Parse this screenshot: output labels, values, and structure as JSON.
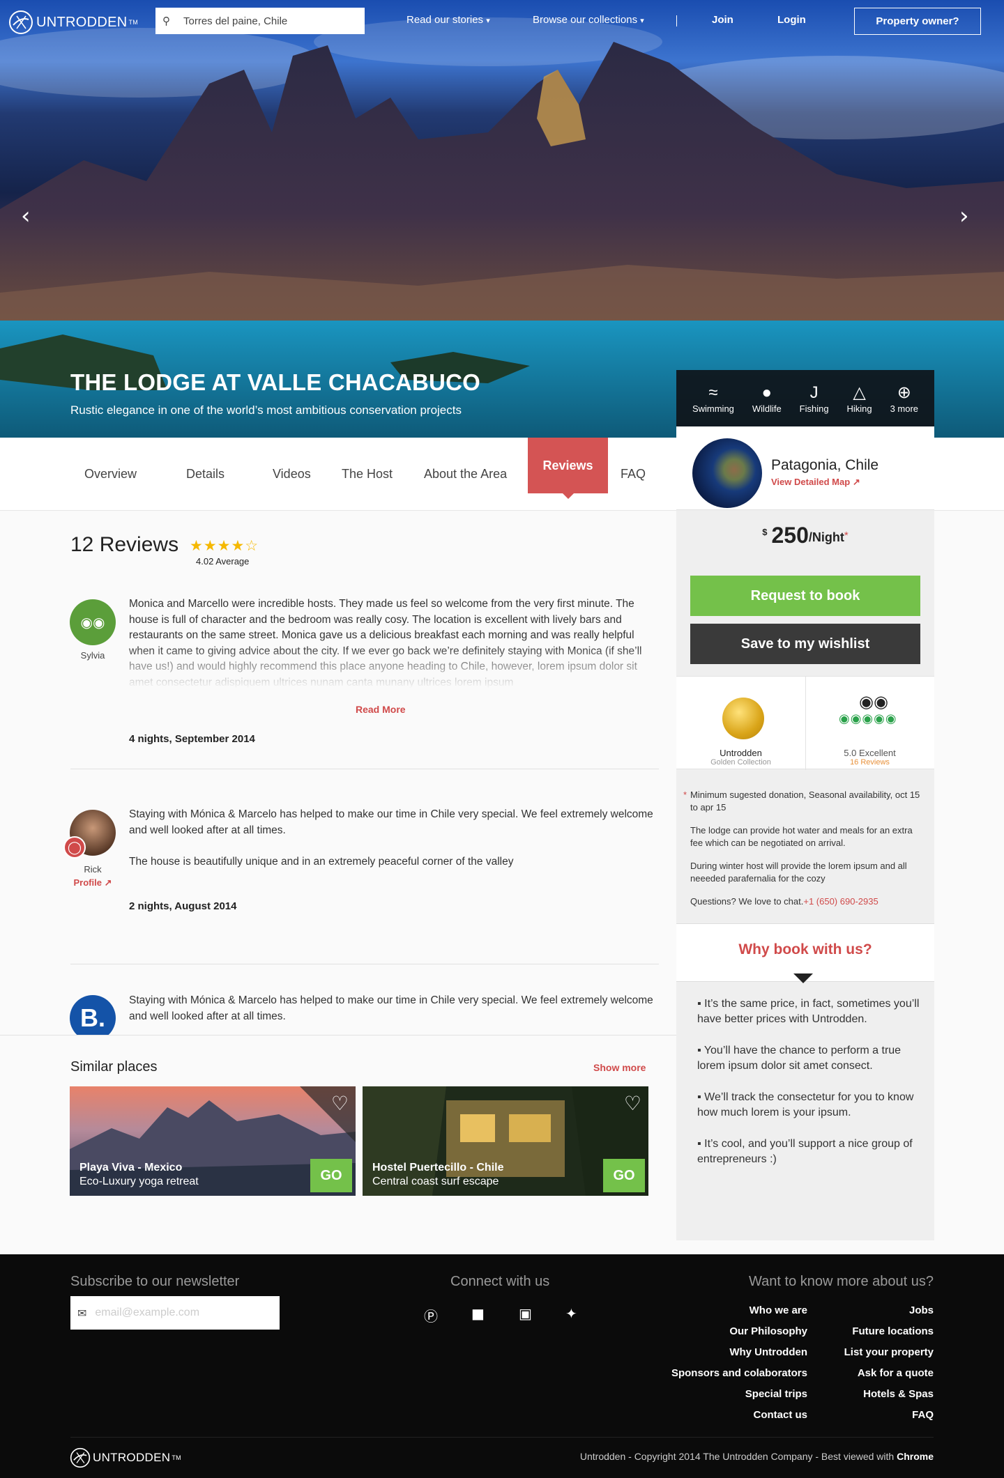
{
  "header": {
    "logo_text": "UNTRODDEN",
    "logo_tm": "TM",
    "search_value": "Torres del paine, Chile",
    "nav_stories": "Read our stories",
    "nav_collections": "Browse our collections",
    "join": "Join",
    "login": "Login",
    "owner_button": "Property owner?"
  },
  "hero": {
    "title": "THE LODGE AT VALLE CHACABUCO",
    "subtitle": "Rustic elegance in one of the world’s most ambitious conservation projects"
  },
  "amenities": [
    {
      "label": "Swimming",
      "icon": "swimming-icon"
    },
    {
      "label": "Wildlife",
      "icon": "paw-icon"
    },
    {
      "label": "Fishing",
      "icon": "fishing-hook-icon"
    },
    {
      "label": "Hiking",
      "icon": "hiking-icon"
    },
    {
      "label": "3 more",
      "icon": "plus-circle-icon"
    }
  ],
  "tabs": [
    "Overview",
    "Details",
    "Videos",
    "The Host",
    "About the Area",
    "Reviews",
    "FAQ"
  ],
  "sidebar": {
    "location": "Patagonia, Chile",
    "map_link": "View Detailed Map",
    "currency": "$",
    "price": "250",
    "per": "/Night",
    "asterisk": "*",
    "book_button": "Request to book",
    "wishlist_button": "Save to my wishlist",
    "badge_golden_title": "Untrodden",
    "badge_golden_sub": "Golden Collection",
    "badge_ta_title": "5.0 Excellent",
    "badge_ta_sub": "16 Reviews",
    "note1": "Minimum sugested donation, Seasonal availability, oct 15 to apr 15",
    "note2": "The lodge can provide hot water and meals for an extra fee which can be negotiated on arrival.",
    "note3": "During winter host will provide the lorem ipsum and all neeeded parafernalia for the cozy",
    "note4": "Questions? We love to chat.",
    "phone": "+1 (650) 690-2935",
    "why_title": "Why book with us?",
    "why_points": [
      "It’s the same price, in fact, sometimes you’ll have better prices with Untrodden.",
      "You’ll have the chance to perform a true lorem ipsum dolor sit amet consect.",
      "We’ll track the consectetur for you to know how much lorem is your ipsum.",
      "It’s cool, and you’ll support a nice group of entrepreneurs :)"
    ]
  },
  "reviews": {
    "heading": "12 Reviews",
    "stars": "★★★★☆",
    "rating": 4.02,
    "average_label": "4.02 Average",
    "items": [
      {
        "name": "Sylvia",
        "text": "Monica and Marcello were incredible hosts. They made us feel so welcome from the very first minute. The house is full of character and the bedroom was really cosy. The location is excellent with lively bars and restaurants on the same street. Monica gave us a delicious breakfast each morning and was really helpful when it came to giving advice about the city. If we ever go back we’re definitely staying with Monica (if she’ll have us!) and would highly recommend this place anyone heading to Chile, however, lorem ipsum dolor sit amet consectetur adispiquem ultrices nunam canta munany ultrices lorem ipsum",
        "read_more": "Read More",
        "stay": "4 nights, September 2014"
      },
      {
        "name": "Rick",
        "profile": "Profile",
        "text1": "Staying with Mónica & Marcelo has helped to make our time in Chile very special. We feel extremely welcome and well looked after at all times.",
        "text2": "The house is beautifully unique and in an extremely peaceful corner of the valley",
        "stay": "2 nights, August 2014"
      },
      {
        "text": "Staying with Mónica & Marcelo has helped to make our time in Chile very special. We feel extremely welcome and well looked after at all times."
      }
    ]
  },
  "similar": {
    "title": "Similar places",
    "show_more": "Show more",
    "cards": [
      {
        "title": "Playa Viva - Mexico",
        "subtitle": "Eco-Luxury yoga retreat",
        "go": "GO"
      },
      {
        "title": "Hostel Puertecillo - Chile",
        "subtitle": "Central coast surf escape",
        "go": "GO"
      }
    ]
  },
  "footer": {
    "newsletter_title": "Subscribe to our newsletter",
    "email_placeholder": "email@example.com",
    "connect_title": "Connect with us",
    "more_title": "Want to know more about us?",
    "links_left": [
      "Who we are",
      "Our Philosophy",
      "Why Untrodden",
      "Sponsors and colaborators",
      "Special trips",
      "Contact us"
    ],
    "links_right": [
      "Jobs",
      "Future locations",
      "List your property",
      "Ask for a quote",
      "Hotels & Spas",
      "FAQ"
    ],
    "copyright": "Untrodden - Copyright 2014 The Untrodden Company - Best viewed with",
    "chrome": "Chrome"
  },
  "colors": {
    "accent": "#d45454",
    "green": "#74c14a",
    "dark": "#3a3a3a"
  }
}
